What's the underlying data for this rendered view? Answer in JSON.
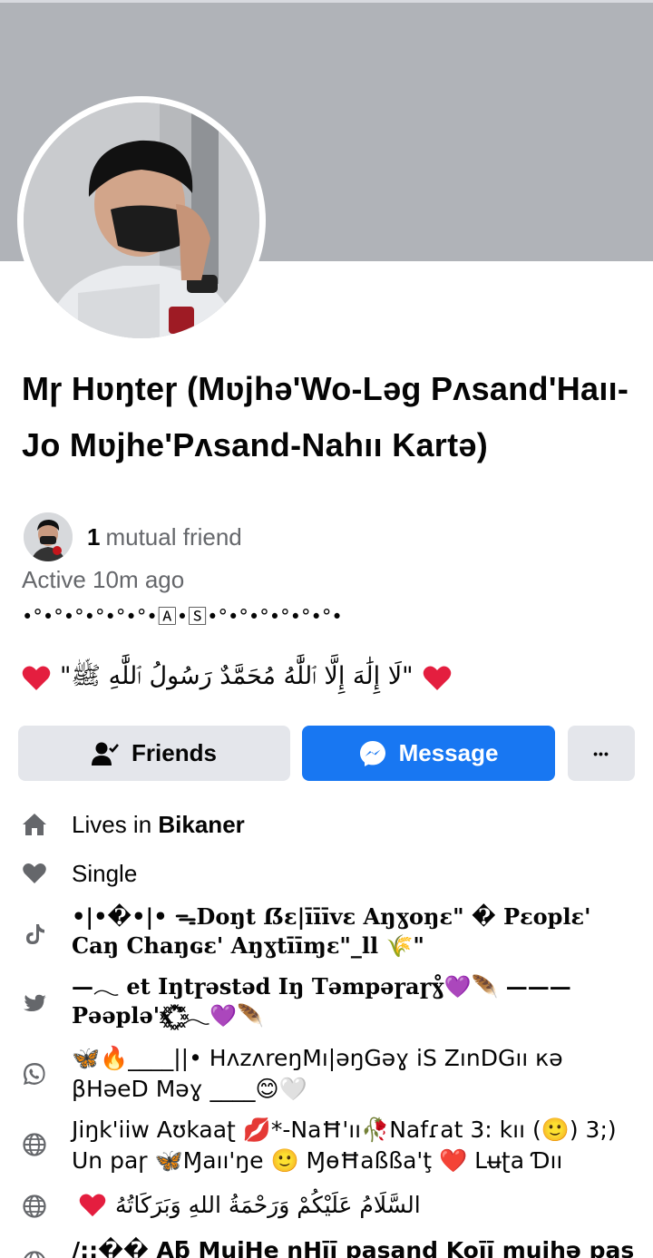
{
  "profile": {
    "name": "Mɼ Hʋŋteɼ (Mʋjhə'Wo-Ləg Pʌsand'Haıı-Jo Mʋjhe'Pʌsand-Nahıı Kartə)",
    "mutual_count": "1",
    "mutual_label": "mutual friend",
    "active_status": "Active 10m ago",
    "bio_deco": "•°•°•°•°•°•°•🄰•🅂•°•°•°•°•°•°•",
    "bio_arabic": "\"لَا إِلَٰهَ إِلَّا ٱللَّٰهُ مُحَمَّدٌ رَسُولُ ٱللَّٰهِ ﷺ\""
  },
  "actions": {
    "friends_label": "Friends",
    "message_label": "Message",
    "more_label": "•••"
  },
  "details": {
    "lives_prefix": "Lives in ",
    "lives_city": "Bikaner",
    "relationship": "Single",
    "tiktok_text": "•|•�•|• ᯓDoŋt ẞɛ|īīīvɛ Aŋɣoŋɛ\" �  Pɛoplɛ' Caŋ Chaŋɢɛ' Aŋɣtīīɱɛ\"_ll 🌾\"",
    "twitter_text": "—𓂃  et Iŋtɼəstəd Iŋ Təmpəɼaɼɣ̊💜🪶 ———Pəəplə'x꙰ʾ꙰ʾ𓂃💜🪶",
    "whatsapp_text": "🦋🔥____||• HʌzʌreŋMı|əŋGəɣ iS        ZınDGıı кə  βHəeD Məɣ ____😊🤍",
    "web1_text": "Jiŋk'iiw Aʊkaaʈ 💋*-NaĦ'ıı🥀Nafɾat 3: kıı (🙂) 3;) Un paɼ 🦋Ɱaıı'ŋe 🙂 ⱮɵĦaßßa'ţ ❤️ Lʉʈa Ɗıı",
    "web2_text": "السَّلَامُ عَلَيْكُمْ وَرَحْمَةُ اللهِ وَبَرَكَاتُهُ",
    "web3_text": "/::�� Aƃ MujHe nHīī pasand Koīī mujhə pasand"
  },
  "colors": {
    "cover": "#b0b3b8",
    "primary_blue": "#1877f2",
    "secondary_button": "#e4e6eb",
    "secondary_text": "#65676b",
    "heart_red": "#e41e3f",
    "icon_gray": "#65676b"
  },
  "icons": [
    "home-icon",
    "heart-icon",
    "tiktok-icon",
    "twitter-icon",
    "whatsapp-icon",
    "globe-icon",
    "messenger-icon",
    "add-friend-icon"
  ]
}
